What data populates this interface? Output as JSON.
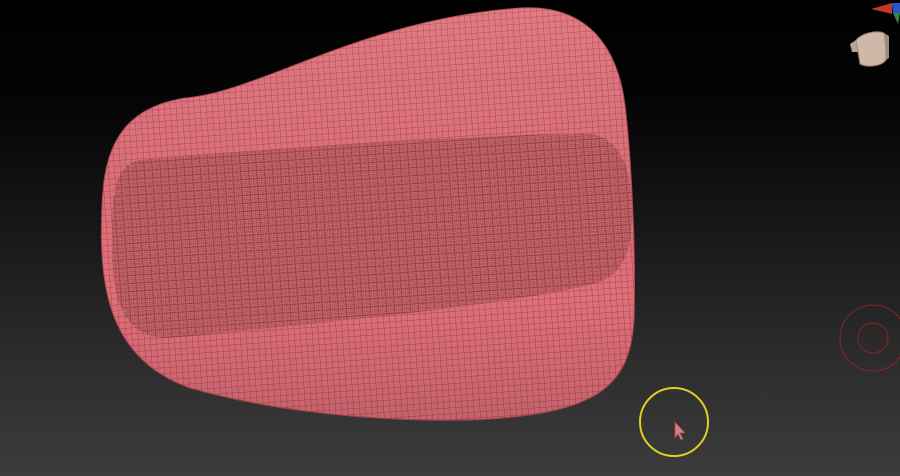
{
  "app": {
    "view": "3d-viewport"
  },
  "colors": {
    "mesh_fill": "#e0707a",
    "mesh_wire": "#7a2a33",
    "inner_panel": "#c86a70",
    "gizmo_x": "#c0392b",
    "gizmo_y": "#2e8b3a",
    "gizmo_z": "#2c55c8",
    "gizmo_head": "#cfb8a8",
    "nav_ring": "#8a2525",
    "brush_ring": "#e0d020",
    "cursor": "#d48080"
  },
  "icons": {
    "orientation_gizmo": "axis-orientation-icon",
    "head_preview": "head-preview-icon",
    "navigation_ring": "navigation-ring-icon",
    "brush": "brush-circle-icon",
    "pointer": "pointer-arrow-icon"
  }
}
